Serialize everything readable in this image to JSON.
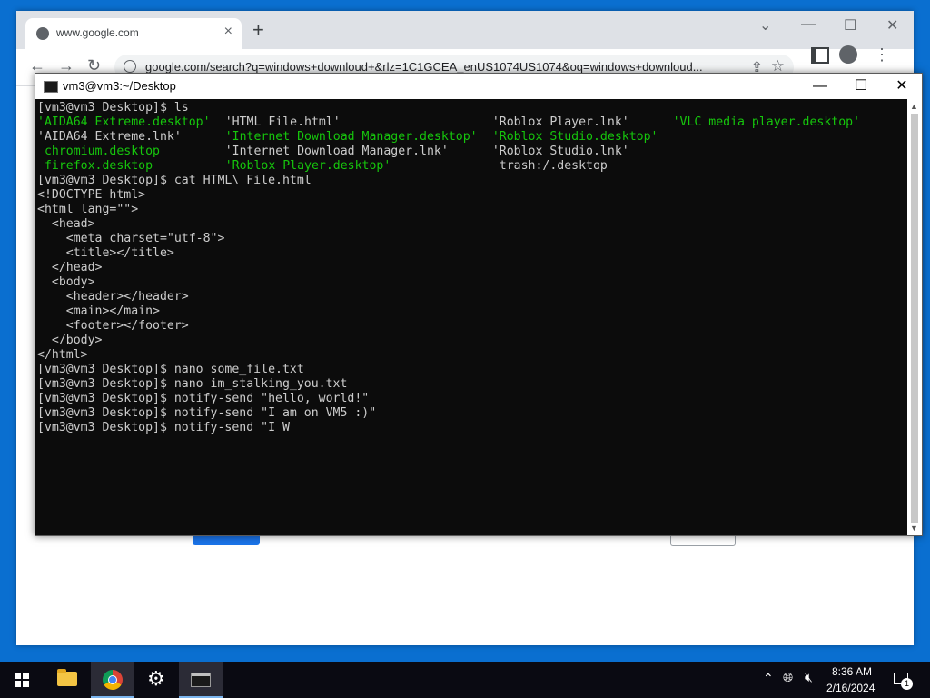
{
  "chrome": {
    "tab_title": "www.google.com",
    "url": "google.com/search?q=windows+downloud+&rlz=1C1GCEA_enUS1074US1074&oq=windows+downloud..."
  },
  "terminal": {
    "title": "vm3@vm3:~/Desktop",
    "lines": [
      [
        {
          "t": "[vm3@vm3 Desktop]$ ls",
          "c": ""
        }
      ],
      [
        {
          "t": "'AIDA64 Extreme.desktop'",
          "c": "green",
          "col": 0
        },
        {
          "t": "'HTML File.html'",
          "c": "",
          "col": 26
        },
        {
          "t": "'Roblox Player.lnk'",
          "c": "",
          "col": 63
        },
        {
          "t": "'VLC media player.desktop'",
          "c": "green",
          "col": 88
        }
      ],
      [
        {
          "t": "'AIDA64 Extreme.lnk'",
          "c": "",
          "col": 0
        },
        {
          "t": "'Internet Download Manager.desktop'",
          "c": "green",
          "col": 26
        },
        {
          "t": "'Roblox Studio.desktop'",
          "c": "green",
          "col": 63
        }
      ],
      [
        {
          "t": " chromium.desktop",
          "c": "green",
          "col": 0
        },
        {
          "t": "'Internet Download Manager.lnk'",
          "c": "",
          "col": 26
        },
        {
          "t": "'Roblox Studio.lnk'",
          "c": "",
          "col": 63
        }
      ],
      [
        {
          "t": " firefox.desktop",
          "c": "green",
          "col": 0
        },
        {
          "t": "'Roblox Player.desktop'",
          "c": "green",
          "col": 26
        },
        {
          "t": " trash:/.desktop",
          "c": "",
          "col": 63
        }
      ],
      [
        {
          "t": "[vm3@vm3 Desktop]$ cat HTML\\ File.html",
          "c": ""
        }
      ],
      [
        {
          "t": "<!DOCTYPE html>",
          "c": ""
        }
      ],
      [
        {
          "t": "<html lang=\"\">",
          "c": ""
        }
      ],
      [
        {
          "t": "  <head>",
          "c": ""
        }
      ],
      [
        {
          "t": "    <meta charset=\"utf-8\">",
          "c": ""
        }
      ],
      [
        {
          "t": "    <title></title>",
          "c": ""
        }
      ],
      [
        {
          "t": "  </head>",
          "c": ""
        }
      ],
      [
        {
          "t": "  <body>",
          "c": ""
        }
      ],
      [
        {
          "t": "    <header></header>",
          "c": ""
        }
      ],
      [
        {
          "t": "    <main></main>",
          "c": ""
        }
      ],
      [
        {
          "t": "    <footer></footer>",
          "c": ""
        }
      ],
      [
        {
          "t": "  </body>",
          "c": ""
        }
      ],
      [
        {
          "t": "</html>",
          "c": ""
        }
      ],
      [
        {
          "t": "[vm3@vm3 Desktop]$ nano some_file.txt",
          "c": ""
        }
      ],
      [
        {
          "t": "[vm3@vm3 Desktop]$ nano im_stalking_you.txt",
          "c": ""
        }
      ],
      [
        {
          "t": "[vm3@vm3 Desktop]$ notify-send \"hello, world!\"",
          "c": ""
        }
      ],
      [
        {
          "t": "[vm3@vm3 Desktop]$ notify-send \"I am on VM5 :)\"",
          "c": ""
        }
      ],
      [
        {
          "t": "[vm3@vm3 Desktop]$ notify-send \"I W",
          "c": ""
        }
      ]
    ]
  },
  "taskbar": {
    "time": "8:36 AM",
    "date": "2/16/2024",
    "notification_count": "1"
  }
}
